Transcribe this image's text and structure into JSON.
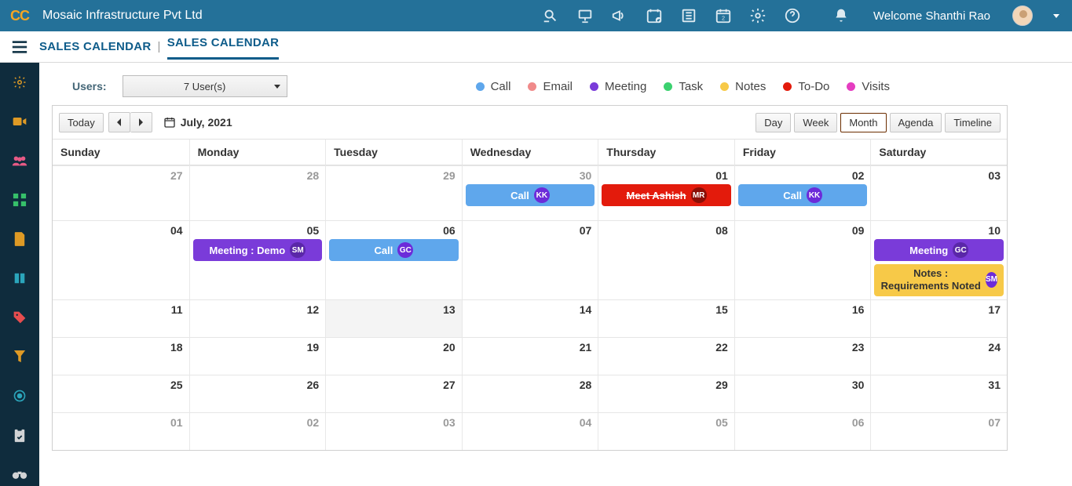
{
  "header": {
    "logo_text": "CC",
    "company": "Mosaic Infrastructure Pvt Ltd",
    "welcome": "Welcome Shanthi Rao"
  },
  "breadcrumb": {
    "root": "SALES CALENDAR",
    "current": "SALES CALENDAR"
  },
  "users": {
    "label": "Users:",
    "selected": "7 User(s)"
  },
  "legend": {
    "items": [
      {
        "label": "Call",
        "color": "#5fa7ec"
      },
      {
        "label": "Email",
        "color": "#f08a8a"
      },
      {
        "label": "Meeting",
        "color": "#7a3bd9"
      },
      {
        "label": "Task",
        "color": "#3bd16f"
      },
      {
        "label": "Notes",
        "color": "#f7c948"
      },
      {
        "label": "To-Do",
        "color": "#e31b0c"
      },
      {
        "label": "Visits",
        "color": "#e53dc0"
      }
    ]
  },
  "calendar": {
    "today_label": "Today",
    "period": "July, 2021",
    "views": [
      "Day",
      "Week",
      "Month",
      "Agenda",
      "Timeline"
    ],
    "active_view": "Month",
    "day_names": [
      "Sunday",
      "Monday",
      "Tuesday",
      "Wednesday",
      "Thursday",
      "Friday",
      "Saturday"
    ],
    "weeks": [
      {
        "tall": true,
        "cells": [
          {
            "num": "27",
            "in_month": false
          },
          {
            "num": "28",
            "in_month": false
          },
          {
            "num": "29",
            "in_month": false
          },
          {
            "num": "30",
            "in_month": false,
            "events": [
              {
                "type": "call",
                "title": "Call",
                "badge": "KK"
              }
            ]
          },
          {
            "num": "01",
            "in_month": true,
            "events": [
              {
                "type": "todo",
                "title": "Meet Ashish",
                "badge": "MR"
              }
            ]
          },
          {
            "num": "02",
            "in_month": true,
            "events": [
              {
                "type": "call",
                "title": "Call",
                "badge": "KK"
              }
            ]
          },
          {
            "num": "03",
            "in_month": true
          }
        ]
      },
      {
        "tall": true,
        "extra": true,
        "cells": [
          {
            "num": "04",
            "in_month": true
          },
          {
            "num": "05",
            "in_month": true,
            "events": [
              {
                "type": "meeting",
                "title": "Meeting : Demo",
                "badge": "SM"
              }
            ]
          },
          {
            "num": "06",
            "in_month": true,
            "events": [
              {
                "type": "call",
                "title": "Call",
                "badge": "GC"
              }
            ]
          },
          {
            "num": "07",
            "in_month": true
          },
          {
            "num": "08",
            "in_month": true
          },
          {
            "num": "09",
            "in_month": true
          },
          {
            "num": "10",
            "in_month": true,
            "events": [
              {
                "type": "meeting",
                "title": "Meeting",
                "badge": "GC"
              },
              {
                "type": "notes",
                "title": "Notes : Requirements Noted",
                "badge": "SM"
              }
            ]
          }
        ]
      },
      {
        "cells": [
          {
            "num": "11",
            "in_month": true
          },
          {
            "num": "12",
            "in_month": true
          },
          {
            "num": "13",
            "in_month": true,
            "shade": true
          },
          {
            "num": "14",
            "in_month": true
          },
          {
            "num": "15",
            "in_month": true
          },
          {
            "num": "16",
            "in_month": true
          },
          {
            "num": "17",
            "in_month": true
          }
        ]
      },
      {
        "cells": [
          {
            "num": "18",
            "in_month": true
          },
          {
            "num": "19",
            "in_month": true
          },
          {
            "num": "20",
            "in_month": true
          },
          {
            "num": "21",
            "in_month": true
          },
          {
            "num": "22",
            "in_month": true
          },
          {
            "num": "23",
            "in_month": true
          },
          {
            "num": "24",
            "in_month": true
          }
        ]
      },
      {
        "cells": [
          {
            "num": "25",
            "in_month": true
          },
          {
            "num": "26",
            "in_month": true
          },
          {
            "num": "27",
            "in_month": true
          },
          {
            "num": "28",
            "in_month": true
          },
          {
            "num": "29",
            "in_month": true
          },
          {
            "num": "30",
            "in_month": true
          },
          {
            "num": "31",
            "in_month": true
          }
        ]
      },
      {
        "cells": [
          {
            "num": "01",
            "in_month": false
          },
          {
            "num": "02",
            "in_month": false
          },
          {
            "num": "03",
            "in_month": false
          },
          {
            "num": "04",
            "in_month": false
          },
          {
            "num": "05",
            "in_month": false
          },
          {
            "num": "06",
            "in_month": false
          },
          {
            "num": "07",
            "in_month": false
          }
        ]
      }
    ]
  },
  "sidebar_icons": [
    "gear",
    "video",
    "people",
    "grid",
    "note",
    "book",
    "tag",
    "filter",
    "ring",
    "clipboard",
    "binoculars"
  ]
}
